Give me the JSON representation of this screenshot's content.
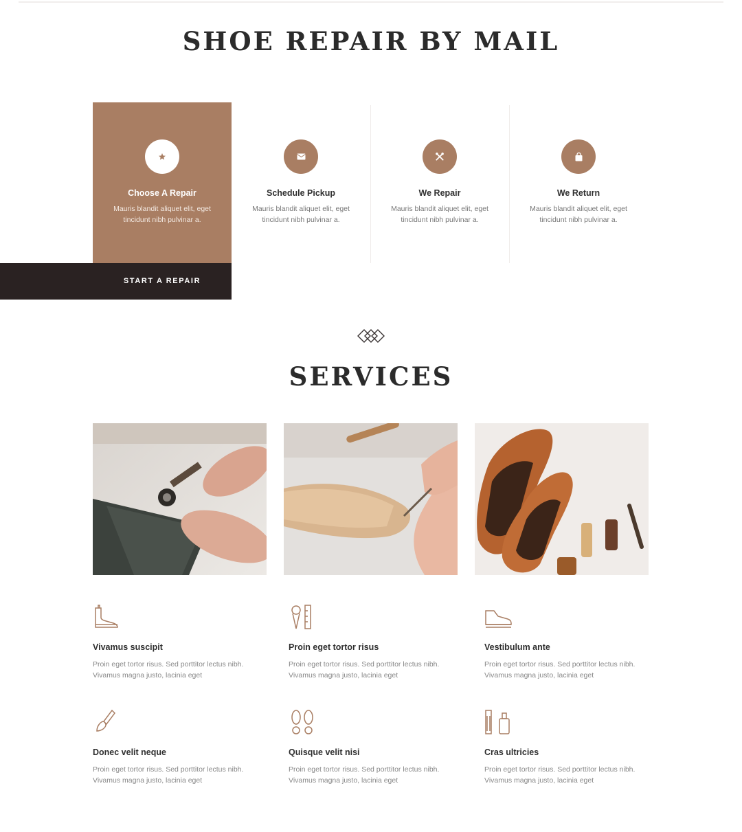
{
  "colors": {
    "accent": "#a97e63",
    "dark": "#2a2222",
    "text": "#2f2f2f",
    "muted": "#888888"
  },
  "mail_section": {
    "title": "SHOE REPAIR BY MAIL",
    "steps": [
      {
        "icon": "star-icon",
        "title": "Choose A Repair",
        "text": "Mauris blandit aliquet elit, eget tincidunt nibh pulvinar a."
      },
      {
        "icon": "envelope-icon",
        "title": "Schedule Pickup",
        "text": "Mauris blandit aliquet elit, eget tincidunt nibh pulvinar a."
      },
      {
        "icon": "tools-icon",
        "title": "We Repair",
        "text": "Mauris blandit aliquet elit, eget tincidunt nibh pulvinar a."
      },
      {
        "icon": "bag-icon",
        "title": "We Return",
        "text": "Mauris blandit aliquet elit, eget tincidunt nibh pulvinar a."
      }
    ],
    "cta_label": "START A REPAIR"
  },
  "services_section": {
    "divider_icon": "diamond-divider-icon",
    "title": "SERVICES",
    "photos": [
      {
        "icon": "leather-cutting-photo"
      },
      {
        "icon": "shoe-last-photo"
      },
      {
        "icon": "leather-shoes-photo"
      }
    ],
    "items": [
      {
        "icon": "boot-icon",
        "title": "Vivamus suscipit",
        "text": "Proin eget tortor risus. Sed porttitor lectus nibh. Vivamus magna justo, lacinia eget"
      },
      {
        "icon": "measuring-tools-icon",
        "title": "Proin eget tortor risus",
        "text": "Proin eget tortor risus. Sed porttitor lectus nibh. Vivamus magna justo, lacinia eget"
      },
      {
        "icon": "shoe-icon",
        "title": "Vestibulum ante",
        "text": "Proin eget tortor risus. Sed porttitor lectus nibh. Vivamus magna justo, lacinia eget"
      },
      {
        "icon": "brush-icon",
        "title": "Donec velit neque",
        "text": "Proin eget tortor risus. Sed porttitor lectus nibh. Vivamus magna justo, lacinia eget"
      },
      {
        "icon": "footprints-icon",
        "title": "Quisque velit nisi",
        "text": "Proin eget tortor risus. Sed porttitor lectus nibh. Vivamus magna justo, lacinia eget"
      },
      {
        "icon": "polish-bottle-icon",
        "title": "Cras ultricies",
        "text": "Proin eget tortor risus. Sed porttitor lectus nibh. Vivamus magna justo, lacinia eget"
      }
    ]
  }
}
